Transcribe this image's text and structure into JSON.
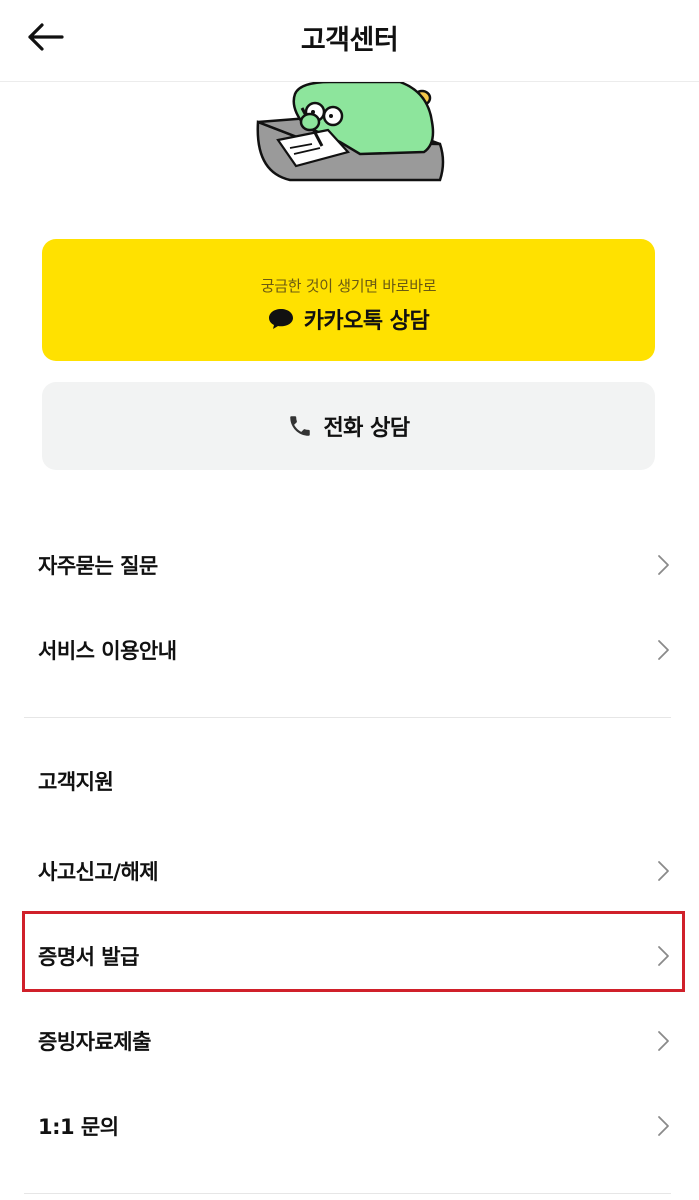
{
  "header": {
    "title": "고객센터",
    "back_icon": "arrow-left-icon"
  },
  "kakao_button": {
    "subtitle": "궁금한 것이 생기면 바로바로",
    "label": "카카오톡 상담",
    "icon": "chat-bubble-icon",
    "bg_color": "#FFE100"
  },
  "phone_button": {
    "label": "전화 상담",
    "icon": "phone-icon",
    "bg_color": "#F2F3F3"
  },
  "menu_top": [
    {
      "label": "자주묻는 질문"
    },
    {
      "label": "서비스 이용안내"
    }
  ],
  "support_section": {
    "title": "고객지원",
    "items": [
      {
        "label": "사고신고/해제"
      },
      {
        "label": "증명서 발급"
      },
      {
        "label": "증빙자료제출"
      },
      {
        "label": "1:1 문의"
      }
    ]
  },
  "highlight_color": "#D0202A"
}
